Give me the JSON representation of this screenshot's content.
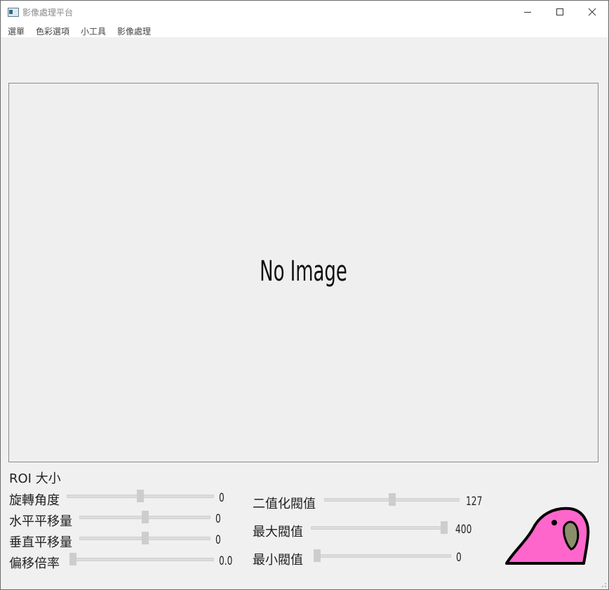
{
  "window": {
    "title": "影像處理平台"
  },
  "menu": {
    "items": [
      {
        "label": "選單"
      },
      {
        "label": "色彩選項"
      },
      {
        "label": "小工具"
      },
      {
        "label": "影像處理"
      }
    ]
  },
  "image_panel": {
    "placeholder": "No Image"
  },
  "roi": {
    "label": "ROI 大小"
  },
  "controls_left": [
    {
      "label": "旋轉角度",
      "value_text": "0",
      "level": 0.5
    },
    {
      "label": "水平平移量",
      "value_text": "0",
      "level": 0.5
    },
    {
      "label": "垂直平移量",
      "value_text": "0",
      "level": 0.5
    },
    {
      "label": "偏移倍率",
      "value_text": "0.0",
      "level": 0.0
    }
  ],
  "controls_right": [
    {
      "label": "二值化閥值",
      "value_text": "127",
      "level": 0.5
    },
    {
      "label": "最大閥值",
      "value_text": "400",
      "level": 1.0
    },
    {
      "label": "最小閥值",
      "value_text": "0",
      "level": 0.0
    }
  ],
  "colors": {
    "mascot_body": "#ff66cc",
    "mascot_beak": "#8a8f6a"
  },
  "icons": {
    "app": "app-window-icon",
    "minimize": "minimize-icon",
    "maximize": "maximize-icon",
    "close": "close-icon",
    "mascot": "party-parrot-icon",
    "grip": "resize-grip-icon"
  }
}
